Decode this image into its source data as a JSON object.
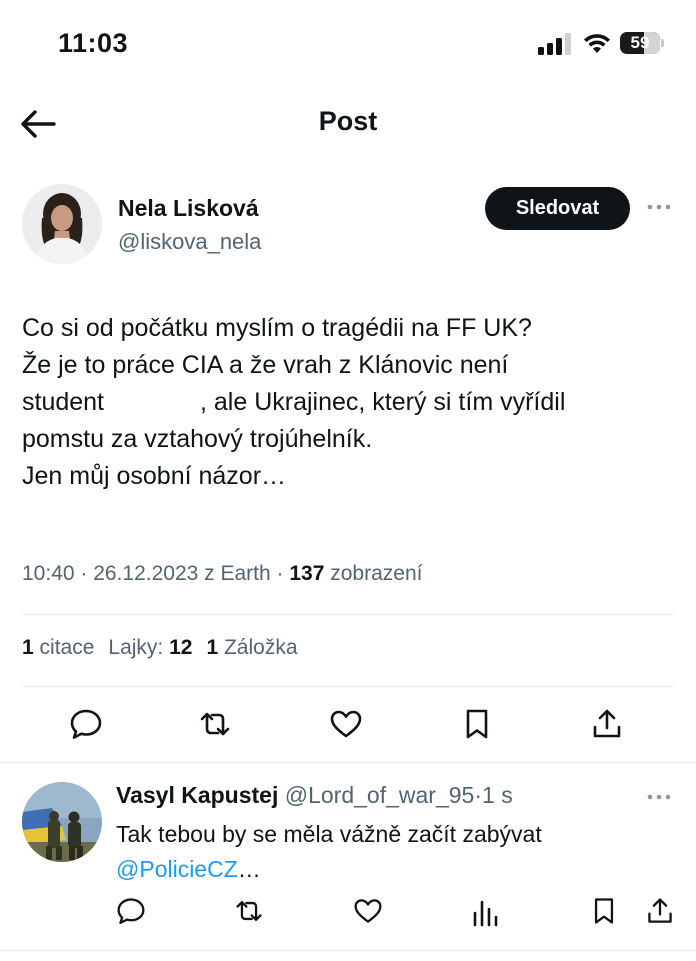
{
  "status_bar": {
    "time": "11:03",
    "battery_level": "59",
    "icons": [
      "cellular-signal-icon",
      "wifi-icon",
      "battery-icon"
    ]
  },
  "header": {
    "title": "Post",
    "back_icon": "arrow-left-icon"
  },
  "post": {
    "author_name": "Nela Lisková",
    "author_handle": "@liskova_nela",
    "follow_label": "Sledovat",
    "more_icon": "more-dots-icon",
    "text_lines": [
      "Co si od počátku myslím o tragédii na FF UK?",
      "Že je to práce CIA a že vrah z Klánovic není",
      "student",
      ", ale Ukrajinec, který si tím vyřídil",
      "pomstu za vztahový trojúhelník.",
      "Jen můj osobní názor…"
    ],
    "meta_prefix": "10:40 · 26.12.2023 z Earth · ",
    "views_count": "137",
    "views_label": "zobrazení",
    "stats": {
      "quotes_count": "1",
      "quotes_label": "citace",
      "likes_label": "Lajky:",
      "likes_count": "12",
      "bookmarks_count": "1",
      "bookmarks_label": "Záložka"
    },
    "actions": [
      "reply-icon",
      "repost-icon",
      "like-icon",
      "bookmark-icon",
      "share-icon"
    ]
  },
  "reply": {
    "author_name": "Vasyl Kapustej",
    "author_handle": "@Lord_of_war_95",
    "time_sep": "·",
    "time": "1 s",
    "text_line1": "Tak tebou by se měla vážně začít zabývat",
    "mention": "@PolicieCZ",
    "ellipsis": "…",
    "actions": [
      "reply-icon",
      "repost-icon",
      "like-icon",
      "views-icon",
      "bookmark-icon",
      "share-icon"
    ]
  },
  "colors": {
    "text": "#0f1419",
    "secondary": "#536471",
    "link": "#1d9bf0",
    "divider": "#e7e9eb",
    "follow_bg": "#0f1419"
  }
}
